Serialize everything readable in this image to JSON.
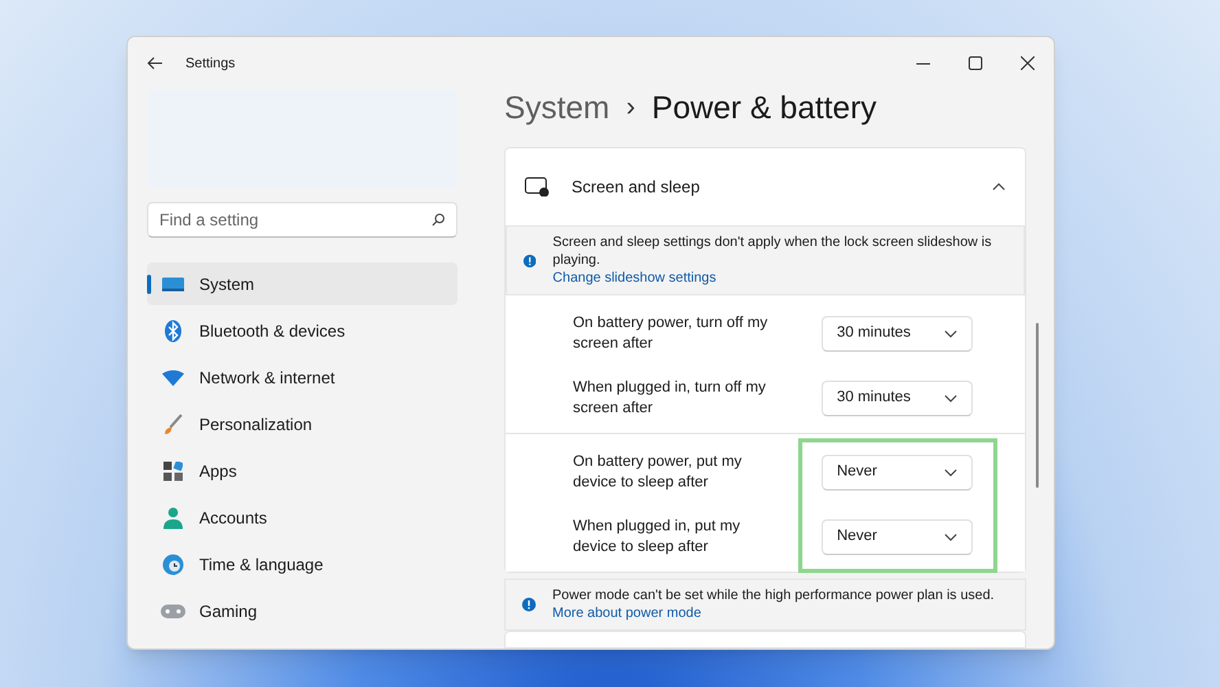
{
  "window": {
    "title": "Settings"
  },
  "search": {
    "placeholder": "Find a setting"
  },
  "sidebar": {
    "items": [
      {
        "label": "System",
        "kind": "system",
        "selected": true
      },
      {
        "label": "Bluetooth & devices",
        "kind": "bluetooth",
        "selected": false
      },
      {
        "label": "Network & internet",
        "kind": "network",
        "selected": false
      },
      {
        "label": "Personalization",
        "kind": "brush",
        "selected": false
      },
      {
        "label": "Apps",
        "kind": "apps",
        "selected": false
      },
      {
        "label": "Accounts",
        "kind": "person",
        "selected": false
      },
      {
        "label": "Time & language",
        "kind": "globe",
        "selected": false
      },
      {
        "label": "Gaming",
        "kind": "gamepad",
        "selected": false
      }
    ]
  },
  "breadcrumb": {
    "parent": "System",
    "separator": "›",
    "current": "Power & battery"
  },
  "screen_and_sleep": {
    "title": "Screen and sleep",
    "expanded": true,
    "notice": {
      "text": "Screen and sleep settings don't apply when the lock screen slideshow is playing.",
      "link": "Change slideshow settings"
    },
    "groups": [
      {
        "highlighted": false,
        "rows": [
          {
            "label": "On battery power, turn off my screen after",
            "value": "30 minutes"
          },
          {
            "label": "When plugged in, turn off my screen after",
            "value": "30 minutes"
          }
        ]
      },
      {
        "highlighted": true,
        "rows": [
          {
            "label": "On battery power, put my device to sleep after",
            "value": "Never"
          },
          {
            "label": "When plugged in, put my device to sleep after",
            "value": "Never"
          }
        ]
      }
    ]
  },
  "power_mode_notice": {
    "text": "Power mode can't be set while the high performance power plan is used.",
    "link": "More about power mode"
  }
}
